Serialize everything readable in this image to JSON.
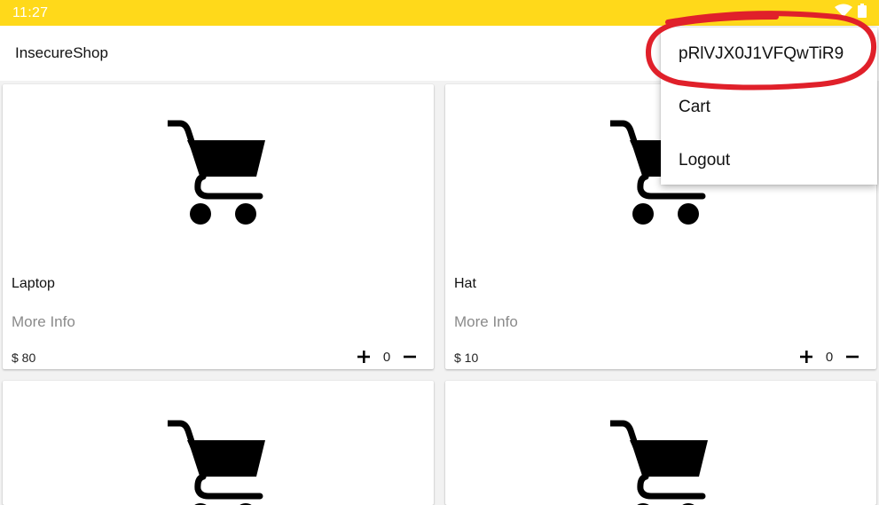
{
  "status_bar": {
    "time": "11:27",
    "icons": [
      "wifi-icon",
      "battery-icon"
    ]
  },
  "app_bar": {
    "title": "InsecureShop"
  },
  "products": [
    {
      "name": "Laptop",
      "more_info": "More Info",
      "price": "$ 80",
      "quantity": "0"
    },
    {
      "name": "Hat",
      "more_info": "More Info",
      "price": "$ 10",
      "quantity": "0"
    },
    {
      "name": "",
      "more_info": "",
      "price": "",
      "quantity": ""
    },
    {
      "name": "",
      "more_info": "",
      "price": "",
      "quantity": ""
    }
  ],
  "overflow_menu": {
    "items": [
      {
        "label": "pRlVJX0J1VFQwTiR9"
      },
      {
        "label": "Cart"
      },
      {
        "label": "Logout"
      }
    ]
  },
  "colors": {
    "status_bar": "#ffd91a",
    "annotation": "#e0202a",
    "secondary_text": "#8a8a8a"
  }
}
